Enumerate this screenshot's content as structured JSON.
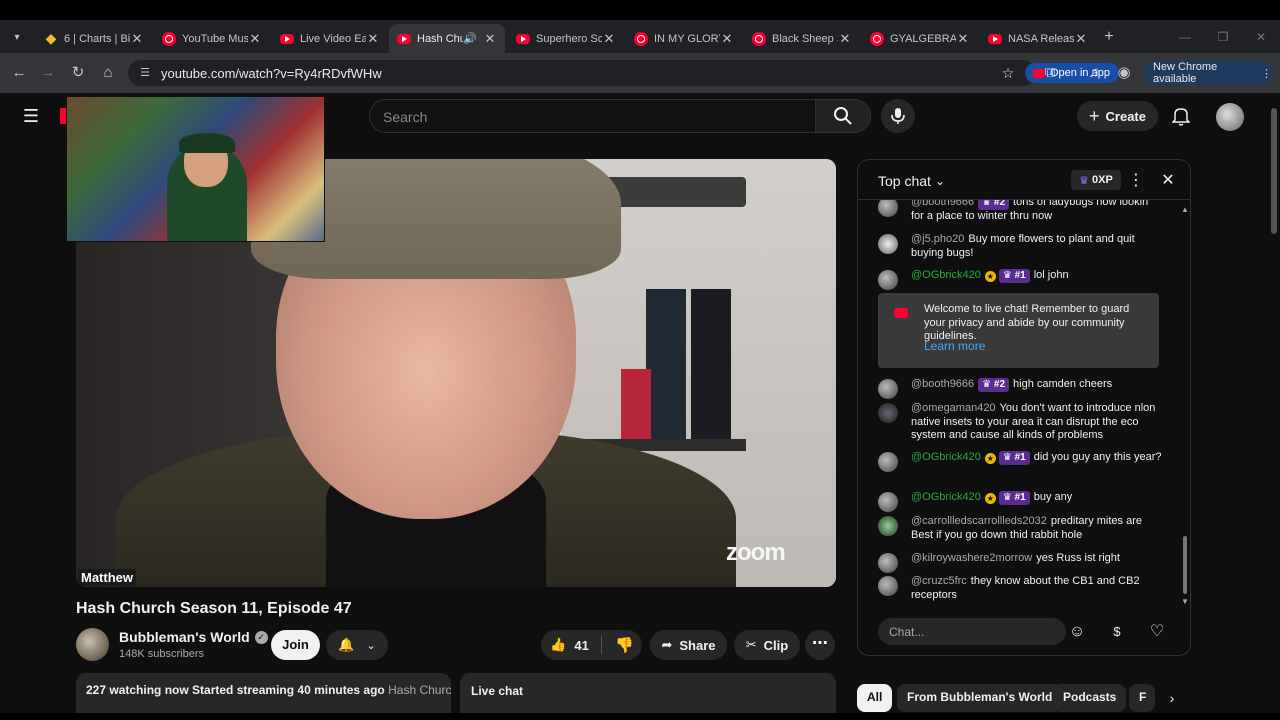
{
  "browser": {
    "tabs": [
      {
        "title": "6 | Charts | Bi",
        "icon": "binance-icon"
      },
      {
        "title": "YouTube Musi",
        "icon": "youtube-music-icon"
      },
      {
        "title": "Live Video Ea",
        "icon": "youtube-icon"
      },
      {
        "title": "Hash Chu",
        "icon": "youtube-icon",
        "active": true
      },
      {
        "title": "Superhero Sc",
        "icon": "youtube-icon"
      },
      {
        "title": "IN MY GLORY",
        "icon": "youtube-music-icon"
      },
      {
        "title": "Black Sheep S",
        "icon": "youtube-music-icon"
      },
      {
        "title": "GYALGEBRA",
        "icon": "youtube-music-icon"
      },
      {
        "title": "NASA Releas",
        "icon": "youtube-icon"
      }
    ],
    "url": "youtube.com/watch?v=Ry4rRDvfWHw",
    "open_in_app": "Open in app",
    "new_chrome": "New Chrome available"
  },
  "youtube": {
    "search_placeholder": "Search",
    "create_label": "Create",
    "accent": "#ff0033"
  },
  "video": {
    "speaker_label": "Matthew",
    "watermark": "zoom",
    "title": "Hash Church Season 11, Episode 47",
    "channel": "Bubbleman's World",
    "subscribers": "148K subscribers",
    "join_label": "Join",
    "likes": "41",
    "share_label": "Share",
    "clip_label": "Clip",
    "watching": "227 watching now",
    "started": "Started streaming 40 minutes ago",
    "hashtag": "Hash Church",
    "live_chat_label": "Live chat"
  },
  "chat": {
    "header": "Top chat",
    "xp": "0XP",
    "input_placeholder": "Chat...",
    "welcome_text": "Welcome to live chat! Remember to guard your privacy and abide by our community guidelines.",
    "learn_more": "Learn more",
    "messages": [
      {
        "author": "@booth9666",
        "rank": "#2",
        "text": "tons of ladybugs now lookin for a place to winter thru now"
      },
      {
        "author": "@j5.pho20",
        "text": "Buy more flowers to plant and quit buying bugs!"
      },
      {
        "author": "@OGbrick420",
        "rank": "#1",
        "text": "lol john"
      },
      {
        "author": "@booth9666",
        "rank": "#2",
        "text": "high camden cheers"
      },
      {
        "author": "@omegaman420",
        "text": "You don't want to introduce nlon native insets to your area it can disrupt the eco system and cause all kinds of problems"
      },
      {
        "author": "@OGbrick420",
        "rank": "#1",
        "text": "did you guy any this year?"
      },
      {
        "author": "@OGbrick420",
        "rank": "#1",
        "text": "buy any"
      },
      {
        "author": "@carrollledscarrollleds2032",
        "text": "preditary mites are Best if you go down thid rabbit hole"
      },
      {
        "author": "@kilroywashere2morrow",
        "text": "yes Russ ist right"
      },
      {
        "author": "@cruzc5frc",
        "text": "they know about the CB1 and CB2 receptors"
      }
    ]
  },
  "chips": [
    "All",
    "From Bubbleman's World",
    "Podcasts",
    "F"
  ]
}
